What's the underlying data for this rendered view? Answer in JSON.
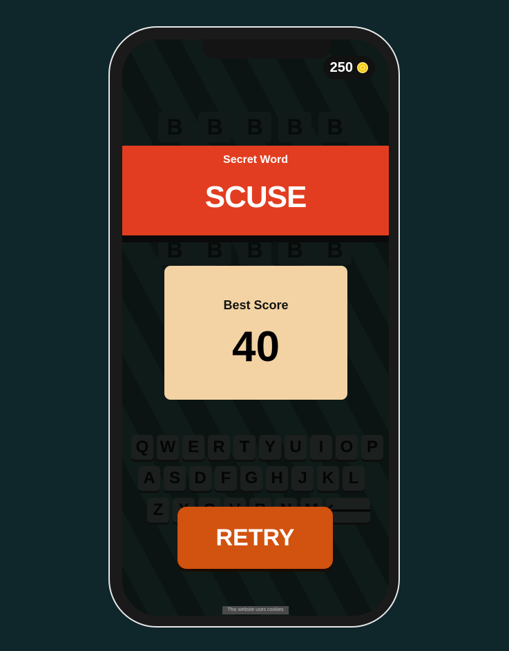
{
  "coins": {
    "value": "250",
    "icon": "coin-icon"
  },
  "tiles": {
    "row1": [
      "B",
      "B",
      "B",
      "B",
      "B"
    ],
    "row2": [
      "B",
      "B",
      "B",
      "B",
      "B"
    ]
  },
  "banner": {
    "label": "Secret Word",
    "word": "SCUSE"
  },
  "best_score": {
    "label": "Best Score",
    "value": "40"
  },
  "keyboard": {
    "row1": [
      "Q",
      "W",
      "E",
      "R",
      "T",
      "Y",
      "U",
      "I",
      "O",
      "P"
    ],
    "row2": [
      "A",
      "S",
      "D",
      "F",
      "G",
      "H",
      "J",
      "K",
      "L"
    ],
    "row3": [
      "Z",
      "X",
      "C",
      "V",
      "B",
      "N",
      "M"
    ],
    "backspace": "🡐"
  },
  "retry_label": "RETRY",
  "footnote": "This website uses cookies",
  "colors": {
    "background": "#0f262b",
    "banner": "#e23d20",
    "score_card": "#f3d3a3",
    "retry": "#d2520f",
    "coin": "#f5c400"
  }
}
